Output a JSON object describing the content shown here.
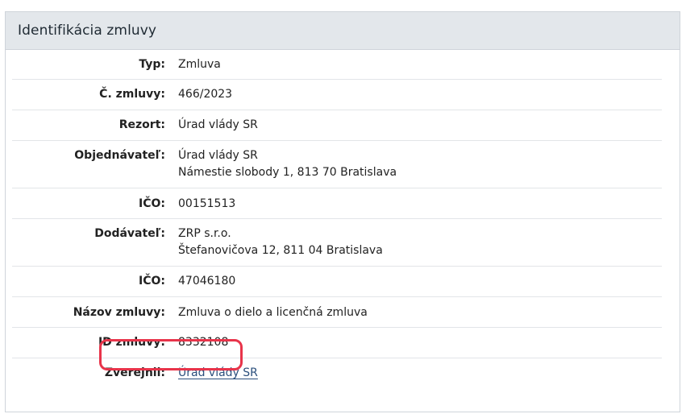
{
  "panel": {
    "title": "Identifikácia zmluvy"
  },
  "fields": {
    "typ": {
      "label": "Typ:",
      "value": "Zmluva"
    },
    "cislo": {
      "label": "Č. zmluvy:",
      "value": "466/2023"
    },
    "rezort": {
      "label": "Rezort:",
      "value": "Úrad vlády SR"
    },
    "objednavatel": {
      "label": "Objednávateľ:",
      "line1": "Úrad vlády SR",
      "line2": "Námestie slobody 1, 813 70 Bratislava"
    },
    "ico1": {
      "label": "IČO:",
      "value": "00151513"
    },
    "dodavatel": {
      "label": "Dodávateľ:",
      "line1": "ZRP s.r.o.",
      "line2": "Štefanovičova 12, 811 04 Bratislava"
    },
    "ico2": {
      "label": "IČO:",
      "value": "47046180"
    },
    "nazov": {
      "label": "Názov zmluvy:",
      "value": "Zmluva o dielo a licenčná zmluva"
    },
    "id": {
      "label": "ID zmluvy:",
      "value": "8332108"
    },
    "zverejnil": {
      "label": "Zverejnil:",
      "value": "Úrad vlády SR"
    }
  },
  "highlight_color": "#e8344a"
}
